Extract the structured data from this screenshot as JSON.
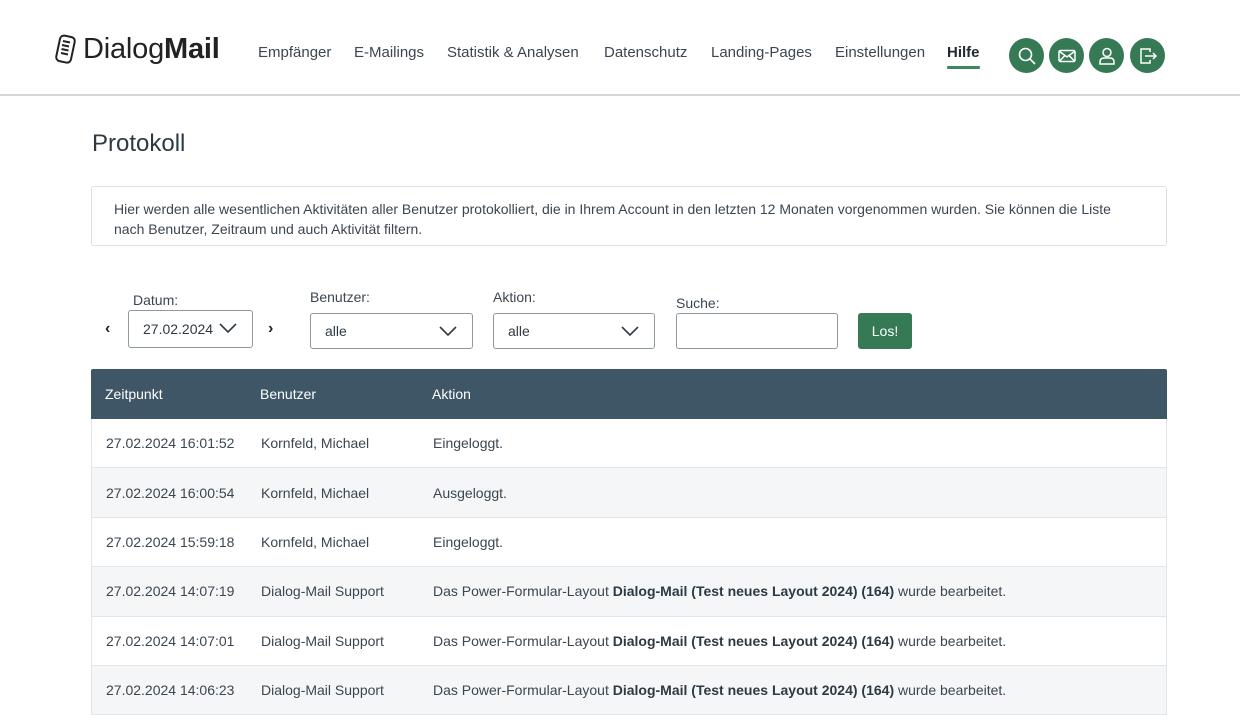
{
  "brand": {
    "part1": "Dialog",
    "part2": "Mail"
  },
  "nav": {
    "items": [
      {
        "label": "Empfänger"
      },
      {
        "label": "E-Mailings"
      },
      {
        "label": "Statistik & Analysen"
      },
      {
        "label": "Datenschutz"
      },
      {
        "label": "Landing-Pages"
      },
      {
        "label": "Einstellungen"
      },
      {
        "label": "Hilfe"
      }
    ],
    "active": "Hilfe"
  },
  "header_icons": [
    "search-icon",
    "mail-icon",
    "user-icon",
    "logout-icon"
  ],
  "page": {
    "title": "Protokoll",
    "info": "Hier werden alle wesentlichen Aktivitäten aller Benutzer protokolliert, die in Ihrem Account in den letzten 12 Monaten vorgenommen wurden. Sie können die Liste nach Benutzer, Zeitraum und auch Aktivität filtern."
  },
  "filters": {
    "date_label": "Datum:",
    "date_value": "27.02.2024",
    "user_label": "Benutzer:",
    "user_value": "alle",
    "action_label": "Aktion:",
    "action_value": "alle",
    "search_label": "Suche:",
    "search_value": "",
    "submit_label": "Los!",
    "prev_arrow": "‹",
    "next_arrow": "›"
  },
  "table": {
    "headers": [
      "Zeitpunkt",
      "Benutzer",
      "Aktion"
    ],
    "rows": [
      {
        "time": "27.02.2024 16:01:52",
        "user": "Kornfeld, Michael",
        "action_pre": "Eingeloggt.",
        "action_bold": "",
        "action_post": ""
      },
      {
        "time": "27.02.2024 16:00:54",
        "user": "Kornfeld, Michael",
        "action_pre": "Ausgeloggt.",
        "action_bold": "",
        "action_post": ""
      },
      {
        "time": "27.02.2024 15:59:18",
        "user": "Kornfeld, Michael",
        "action_pre": "Eingeloggt.",
        "action_bold": "",
        "action_post": ""
      },
      {
        "time": "27.02.2024 14:07:19",
        "user": "Dialog-Mail Support",
        "action_pre": "Das Power-Formular-Layout ",
        "action_bold": "Dialog-Mail (Test neues Layout 2024) (164)",
        "action_post": " wurde bearbeitet."
      },
      {
        "time": "27.02.2024 14:07:01",
        "user": "Dialog-Mail Support",
        "action_pre": "Das Power-Formular-Layout ",
        "action_bold": "Dialog-Mail (Test neues Layout 2024) (164)",
        "action_post": " wurde bearbeitet."
      },
      {
        "time": "27.02.2024 14:06:23",
        "user": "Dialog-Mail Support",
        "action_pre": "Das Power-Formular-Layout ",
        "action_bold": "Dialog-Mail (Test neues Layout 2024) (164)",
        "action_post": " wurde bearbeitet."
      }
    ]
  },
  "colors": {
    "accent": "#367a55",
    "table_header": "#3e5665",
    "active_underline": "#3a8a5c"
  }
}
